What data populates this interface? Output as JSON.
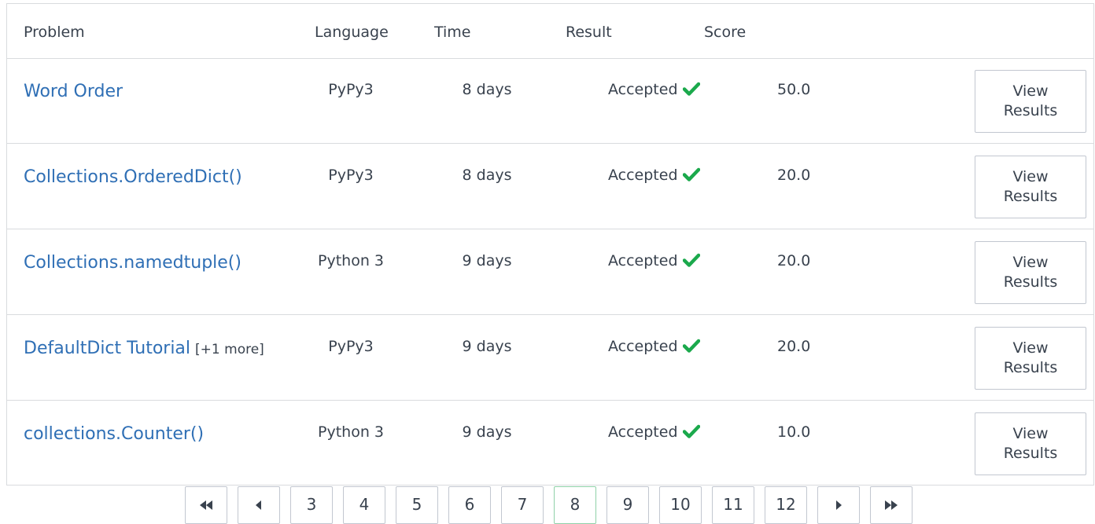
{
  "table": {
    "headers": {
      "problem": "Problem",
      "language": "Language",
      "time": "Time",
      "result": "Result",
      "score": "Score"
    },
    "rows": [
      {
        "problem": "Word Order",
        "extra": "",
        "language": "PyPy3",
        "time": "8 days",
        "result": "Accepted",
        "score": "50.0",
        "button_line1": "View",
        "button_line2": "Results"
      },
      {
        "problem": "Collections.OrderedDict()",
        "extra": "",
        "language": "PyPy3",
        "time": "8 days",
        "result": "Accepted",
        "score": "20.0",
        "button_line1": "View",
        "button_line2": "Results"
      },
      {
        "problem": "Collections.namedtuple()",
        "extra": "",
        "language": "Python 3",
        "time": "9 days",
        "result": "Accepted",
        "score": "20.0",
        "button_line1": "View",
        "button_line2": "Results"
      },
      {
        "problem": "DefaultDict Tutorial",
        "extra": "[+1 more]",
        "language": "PyPy3",
        "time": "9 days",
        "result": "Accepted",
        "score": "20.0",
        "button_line1": "View",
        "button_line2": "Results"
      },
      {
        "problem": "collections.Counter()",
        "extra": "",
        "language": "Python 3",
        "time": "9 days",
        "result": "Accepted",
        "score": "10.0",
        "button_line1": "View",
        "button_line2": "Results"
      }
    ]
  },
  "pagination": {
    "pages": [
      "3",
      "4",
      "5",
      "6",
      "7",
      "8",
      "9",
      "10",
      "11",
      "12"
    ],
    "current": "8",
    "icons": {
      "first": "double-left-arrow-icon",
      "prev": "left-triangle-icon",
      "next": "right-triangle-icon",
      "last": "double-right-arrow-icon"
    }
  },
  "colors": {
    "link": "#2f6fb5",
    "accepted": "#1ba94c",
    "border": "#d9dbde",
    "active_page_border": "#8fd1a8"
  }
}
